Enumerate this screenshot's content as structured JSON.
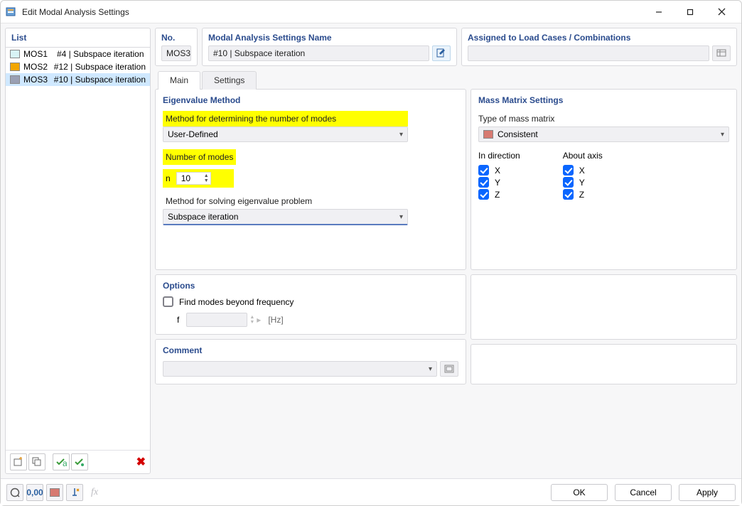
{
  "window": {
    "title": "Edit Modal Analysis Settings"
  },
  "left_panel": {
    "header": "List",
    "items": [
      {
        "code": "MOS1",
        "desc": "#4 | Subspace iteration",
        "color": "#d8f3f5"
      },
      {
        "code": "MOS2",
        "desc": "#12 | Subspace iteration",
        "color": "#f2a600"
      },
      {
        "code": "MOS3",
        "desc": "#10 | Subspace iteration",
        "color": "#9aa0b4"
      }
    ],
    "selected": 2
  },
  "header_boxes": {
    "no_label": "No.",
    "no_value": "MOS3",
    "name_label": "Modal Analysis Settings Name",
    "name_value": "#10 | Subspace iteration",
    "assign_label": "Assigned to Load Cases / Combinations"
  },
  "tabs": {
    "main": "Main",
    "settings": "Settings",
    "active": "main"
  },
  "eigen": {
    "section": "Eigenvalue Method",
    "method_label": "Method for determining the number of modes",
    "method_value": "User-Defined",
    "num_label": "Number of modes",
    "num_sym": "n",
    "num_value": "10",
    "solve_label": "Method for solving eigenvalue problem",
    "solve_value": "Subspace iteration"
  },
  "mass": {
    "section": "Mass Matrix Settings",
    "type_label": "Type of mass matrix",
    "type_value": "Consistent",
    "dir_label": "In direction",
    "axis_label": "About axis",
    "x": "X",
    "y": "Y",
    "z": "Z"
  },
  "options": {
    "section": "Options",
    "find_label": "Find modes beyond frequency",
    "f_sym": "f",
    "unit": "[Hz]"
  },
  "comment": {
    "section": "Comment"
  },
  "footer": {
    "ok": "OK",
    "cancel": "Cancel",
    "apply": "Apply",
    "decimal_icon": "0,00"
  }
}
